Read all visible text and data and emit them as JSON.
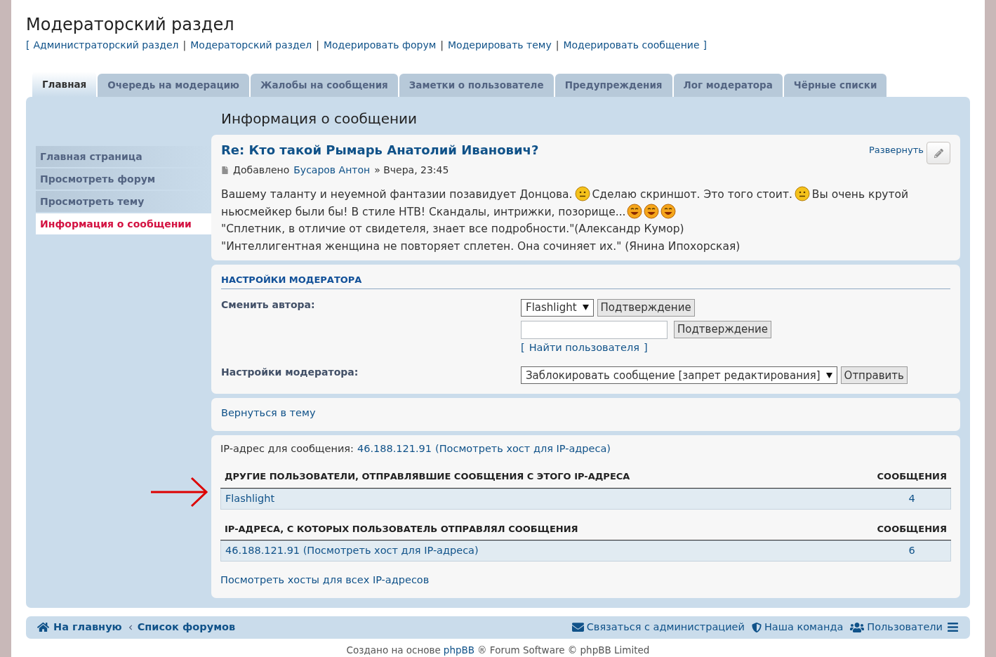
{
  "page_title": "Модераторский раздел",
  "breadcrumbs": [
    {
      "kind": "bracket",
      "text": "["
    },
    {
      "kind": "link",
      "text": "Администраторский раздел"
    },
    {
      "kind": "separator",
      "text": "|"
    },
    {
      "kind": "link",
      "text": "Модераторский раздел"
    },
    {
      "kind": "separator",
      "text": "|"
    },
    {
      "kind": "link",
      "text": "Модерировать форум"
    },
    {
      "kind": "separator",
      "text": "|"
    },
    {
      "kind": "link",
      "text": "Модерировать тему"
    },
    {
      "kind": "separator",
      "text": "|"
    },
    {
      "kind": "link",
      "text": "Модерировать сообщение"
    },
    {
      "kind": "bracket",
      "text": "]"
    }
  ],
  "tabs": [
    {
      "label": "Главная",
      "selected": true
    },
    {
      "label": "Очередь на модерацию",
      "selected": false
    },
    {
      "label": "Жалобы на сообщения",
      "selected": false
    },
    {
      "label": "Заметки о пользователе",
      "selected": false
    },
    {
      "label": "Предупреждения",
      "selected": false
    },
    {
      "label": "Лог модератора",
      "selected": false
    },
    {
      "label": "Чёрные списки",
      "selected": false
    }
  ],
  "sidebar": {
    "items": [
      {
        "label": "Главная страница",
        "selected": false
      },
      {
        "label": "Просмотреть форум",
        "selected": false
      },
      {
        "label": "Просмотреть тему",
        "selected": false
      },
      {
        "label": "Информация о сообщении",
        "selected": true
      }
    ]
  },
  "section_title": "Информация о сообщении",
  "post": {
    "title": "Re: Кто такой Рымарь Анатолий Иванович?",
    "expand": "Развернуть",
    "meta_prefix": "Добавлено",
    "author": "Бусаров Антон",
    "meta_suffix": "» Вчера, 23:45",
    "body": [
      [
        {
          "kind": "text",
          "text": "Вашему таланту и неуемной фантазии позавидует Донцова."
        },
        {
          "kind": "neutral"
        },
        {
          "kind": "text",
          "text": "Сделаю скриншот. Это того стоит."
        },
        {
          "kind": "neutral"
        },
        {
          "kind": "text",
          "text": "Вы очень крутой"
        }
      ],
      [
        {
          "kind": "text",
          "text": "ньюсмейкер были бы! В стиле НТВ! Скандалы, интрижки, позорище..."
        },
        {
          "kind": "grin"
        },
        {
          "kind": "grin"
        },
        {
          "kind": "grin"
        }
      ],
      [
        {
          "kind": "text",
          "text": "\"Сплетник, в отличие от свидетеля, знает все подробности.\"(Александр Кумор)"
        }
      ],
      [
        {
          "kind": "text",
          "text": "\"Интеллигентная женщина не повторяет сплетен. Она сочиняет их.\" (Янина Ипохорская)"
        }
      ]
    ]
  },
  "moderator_settings": {
    "heading": "НАСТРОЙКИ МОДЕРАТОРА",
    "change_author_label": "Сменить автора:",
    "author_select": "Flashlight",
    "confirm_button_1": "Подтверждение",
    "confirm_button_2": "Подтверждение",
    "find_user": {
      "open": "[",
      "label": "Найти пользователя",
      "close": "]"
    },
    "actions_label": "Настройки модератора:",
    "action_select": "Заблокировать сообщение [запрет редактирования]",
    "submit_button": "Отправить"
  },
  "back_link": "Вернуться в тему",
  "ip_info": {
    "label": "IP-адрес для сообщения:",
    "ip": "46.188.121.91",
    "lookup": "(Посмотреть хост для IP-адреса)",
    "tables": [
      {
        "columns": [
          "ДРУГИЕ ПОЛЬЗОВАТЕЛИ, ОТПРАВЛЯВШИЕ СООБЩЕНИЯ С ЭТОГО IP-АДРЕСА",
          "СООБЩЕНИЯ"
        ],
        "rows": [
          [
            "Flashlight",
            "4"
          ]
        ]
      },
      {
        "columns": [
          "IP-АДРЕСА, С КОТОРЫХ ПОЛЬЗОВАТЕЛЬ ОТПРАВЛЯЛ СООБЩЕНИЯ",
          "СООБЩЕНИЯ"
        ],
        "rows": [
          [
            "46.188.121.91 (Посмотреть хост для IP-адреса)",
            "6"
          ]
        ]
      }
    ],
    "all_hosts": "Посмотреть хосты для всех IP-адресов"
  },
  "footer_nav": {
    "left": [
      {
        "kind": "home",
        "label": "На главную"
      },
      {
        "kind": "crumb",
        "label": "Список форумов"
      }
    ],
    "right": [
      {
        "kind": "mail",
        "label": "Связаться с администрацией"
      },
      {
        "kind": "shield",
        "label": "Наша команда"
      },
      {
        "kind": "users",
        "label": "Пользователи"
      }
    ]
  },
  "copyright": {
    "prefix": "Создано на основе",
    "link": "phpBB",
    "suffix": "® Forum Software © phpBB Limited"
  }
}
